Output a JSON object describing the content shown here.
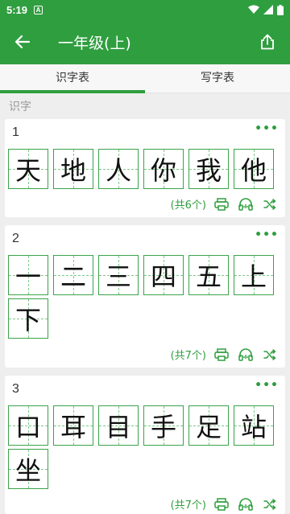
{
  "status": {
    "time": "5:19",
    "notif_icon": "A"
  },
  "appbar": {
    "title": "一年级(上)"
  },
  "tabs": [
    {
      "label": "识字表",
      "active": true
    },
    {
      "label": "写字表",
      "active": false
    }
  ],
  "section_label": "识字",
  "cards": [
    {
      "number": "1",
      "chars": [
        "天",
        "地",
        "人",
        "你",
        "我",
        "他"
      ],
      "count_text": "(共6个)"
    },
    {
      "number": "2",
      "chars": [
        "一",
        "二",
        "三",
        "四",
        "五",
        "上",
        "下"
      ],
      "count_text": "(共7个)"
    },
    {
      "number": "3",
      "chars": [
        "口",
        "耳",
        "目",
        "手",
        "足",
        "站",
        "坐"
      ],
      "count_text": "(共7个)"
    }
  ],
  "more_text": "•••",
  "colors": {
    "primary": "#2f9e3f",
    "background": "#eeeeee"
  }
}
